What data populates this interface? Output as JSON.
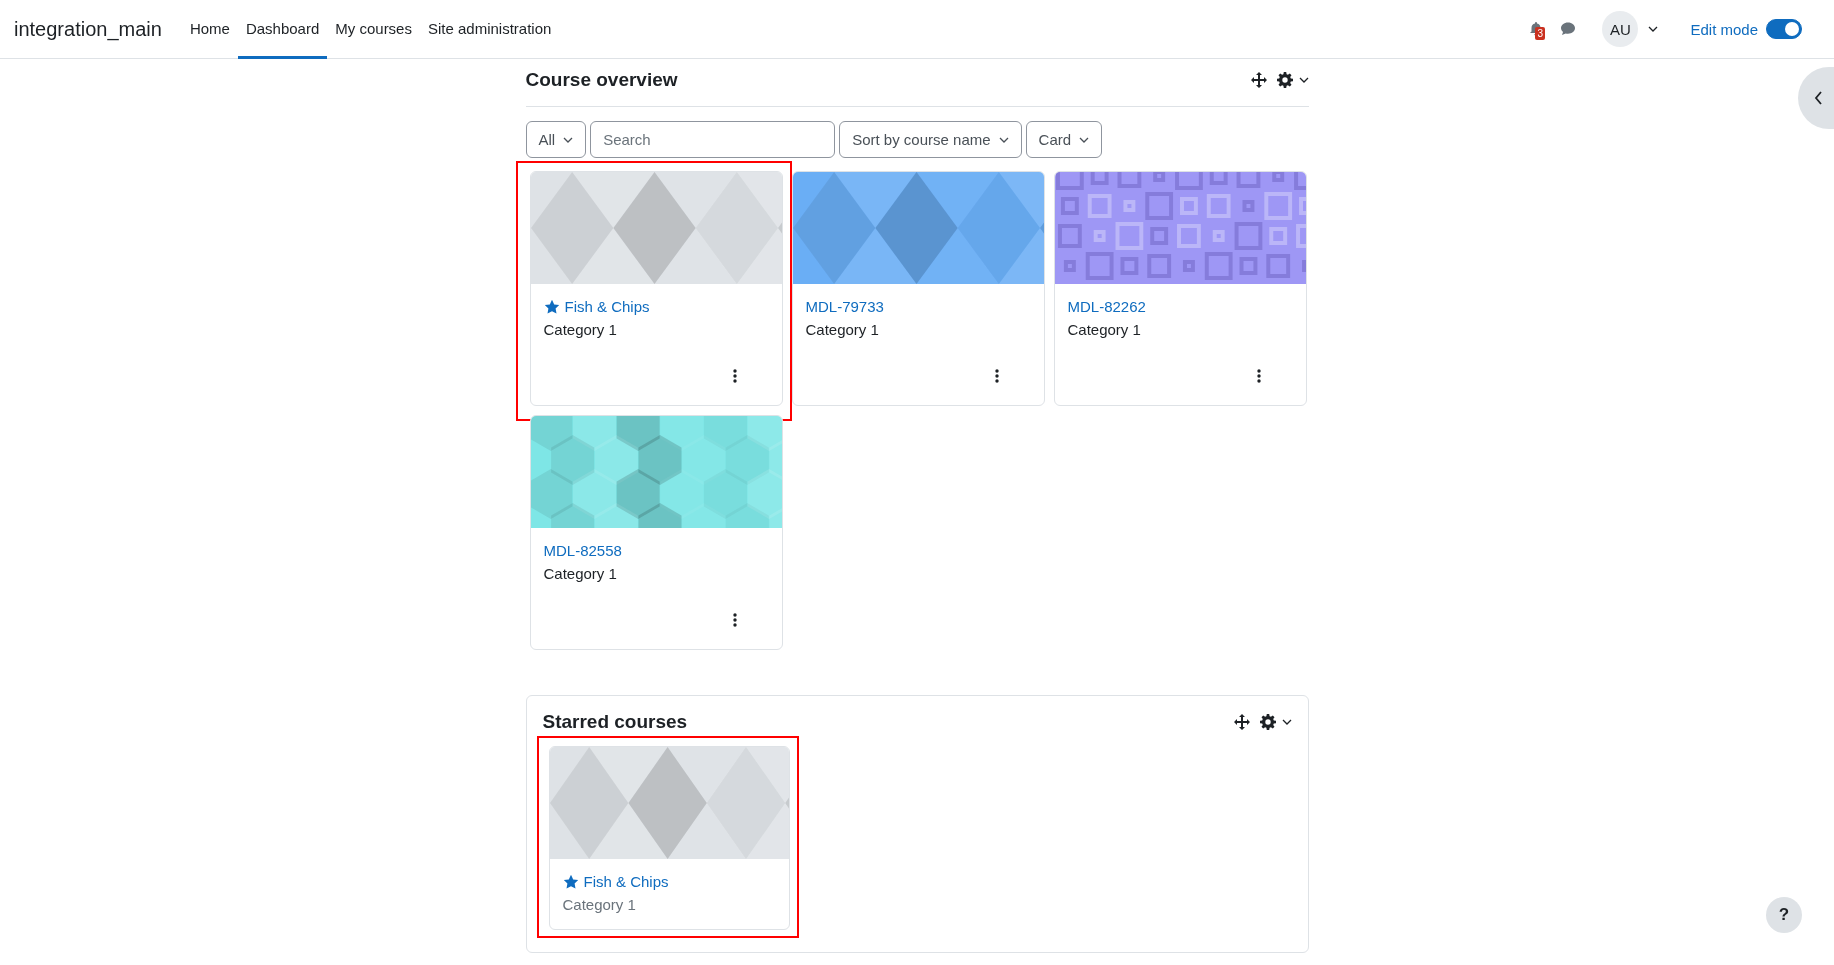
{
  "header": {
    "brand": "integration_main",
    "nav": [
      {
        "label": "Home",
        "selected": false
      },
      {
        "label": "Dashboard",
        "selected": true
      },
      {
        "label": "My courses",
        "selected": false
      },
      {
        "label": "Site administration",
        "selected": false
      }
    ],
    "notification_count": "3",
    "avatar": "AU",
    "edit_mode": {
      "label": "Edit mode",
      "on": true
    }
  },
  "course_overview": {
    "title": "Course overview",
    "filters": {
      "grouping": "All",
      "search": {
        "placeholder": "Search"
      },
      "sort": "Sort by course name",
      "view": "Card"
    },
    "courses": [
      {
        "name": "Fish & Chips",
        "category": "Category 1",
        "starred": true,
        "highlighted": true,
        "image": {
          "kind": "triangles",
          "color": "#dee2e6"
        }
      },
      {
        "name": "MDL-79733",
        "category": "Category 1",
        "starred": false,
        "highlighted": false,
        "image": {
          "kind": "triangles",
          "color": "#6aaef5"
        }
      },
      {
        "name": "MDL-82262",
        "category": "Category 1",
        "starred": false,
        "highlighted": false,
        "image": {
          "kind": "squares",
          "color": "#9e97f5"
        }
      },
      {
        "name": "MDL-82558",
        "category": "Category 1",
        "starred": false,
        "highlighted": false,
        "image": {
          "kind": "hexagons",
          "color": "#7ee6e6"
        }
      }
    ]
  },
  "starred_courses": {
    "title": "Starred courses",
    "courses": [
      {
        "name": "Fish & Chips",
        "category": "Category 1",
        "starred": true,
        "highlighted": true,
        "image": {
          "kind": "triangles",
          "color": "#dee2e6"
        }
      }
    ]
  },
  "help": "?"
}
